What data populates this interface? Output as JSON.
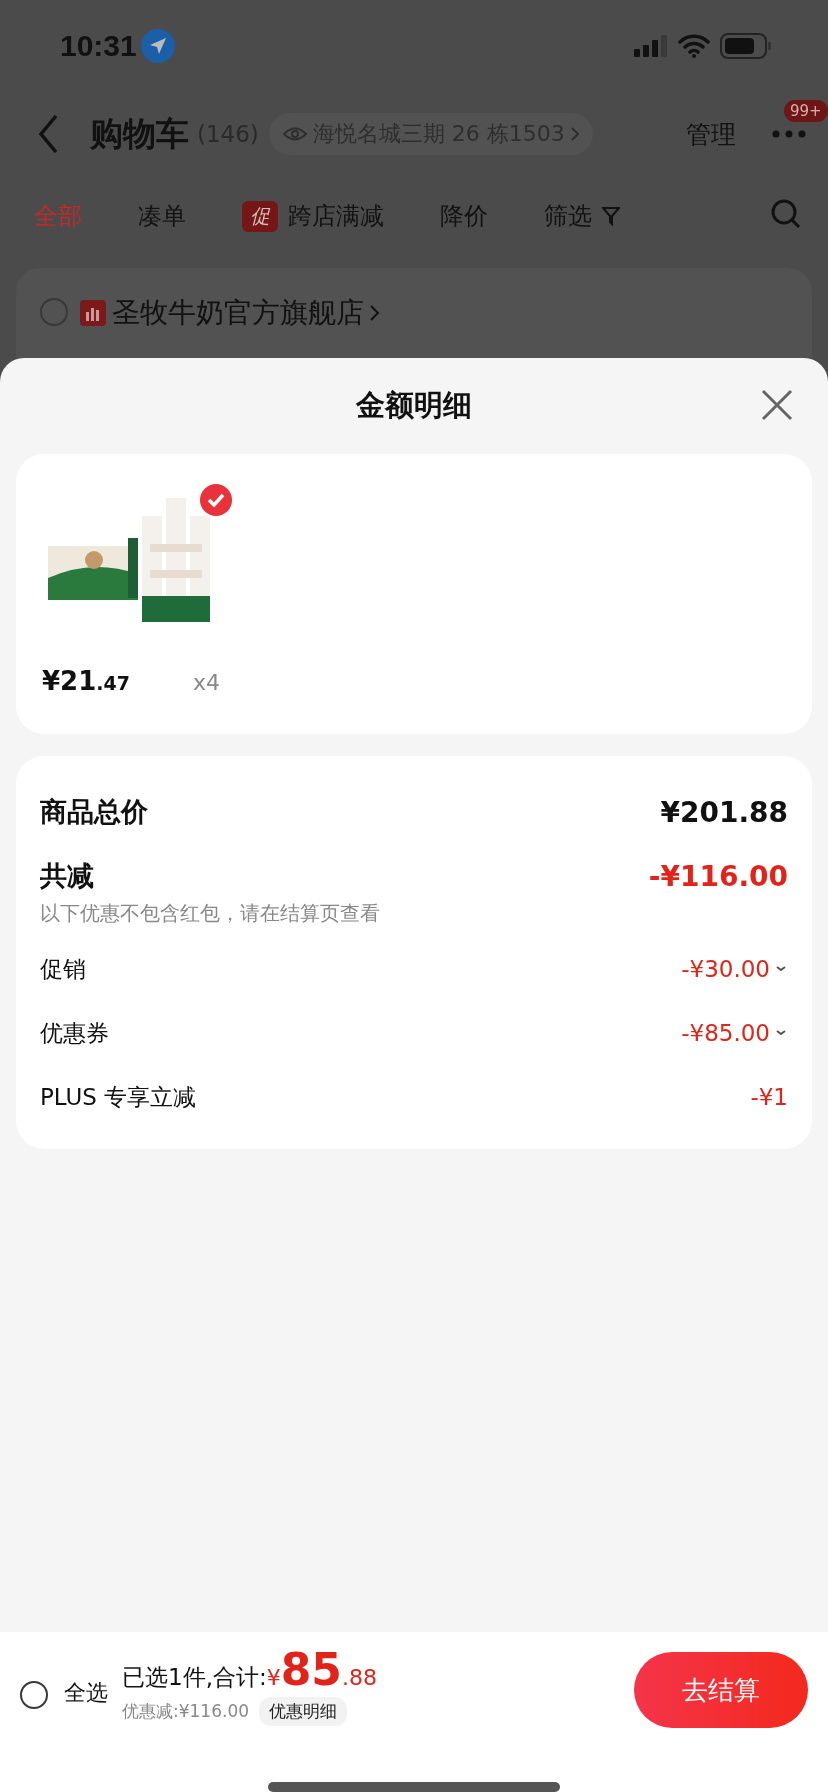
{
  "status_bar": {
    "time": "10:31"
  },
  "nav": {
    "title": "购物车",
    "count": "(146)",
    "address": "海悦名城三期 26 栋1503",
    "manage": "管理",
    "badge": "99+"
  },
  "tabs": [
    {
      "label": "全部",
      "selected": true,
      "kind": "text"
    },
    {
      "label": "凑单",
      "selected": false,
      "kind": "text"
    },
    {
      "label": "跨店满减",
      "selected": false,
      "kind": "promo",
      "tag": "促"
    },
    {
      "label": "降价",
      "selected": false,
      "kind": "text"
    },
    {
      "label": "筛选",
      "selected": false,
      "kind": "filter"
    }
  ],
  "store": {
    "name": "圣牧牛奶官方旗舰店",
    "checked": false
  },
  "sheet": {
    "title": "金额明细"
  },
  "items": [
    {
      "price_main": "¥21",
      "price_decimals": ".47",
      "quantity": "x4",
      "checked": true
    }
  ],
  "summary": {
    "rows": [
      {
        "label": "商品总价",
        "value": "¥201.88",
        "kind": "total"
      },
      {
        "label": "共减",
        "value": "-¥116.00",
        "kind": "discount_total",
        "note": "以下优惠不包含红包，请在结算页查看"
      },
      {
        "label": "促销",
        "value": "-¥30.00",
        "kind": "item",
        "expandable": true
      },
      {
        "label": "优惠券",
        "value": "-¥85.00",
        "kind": "item",
        "expandable": true
      },
      {
        "label": "PLUS 专享立减",
        "value": "-¥1",
        "kind": "item",
        "expandable": false
      }
    ]
  },
  "bottom_bar": {
    "select_all": {
      "label": "全选",
      "checked": false
    },
    "selected_text": "已选1件,合计:",
    "currency": "¥",
    "total_main": "85",
    "total_decimals": ".88",
    "discount": "优惠减:¥116.00",
    "detail_button": "优惠明细",
    "checkout": "去结算"
  }
}
